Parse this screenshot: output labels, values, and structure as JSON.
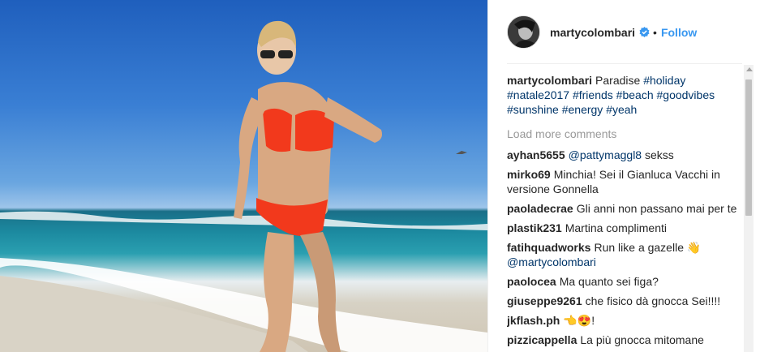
{
  "header": {
    "username": "martycolombari",
    "separator": "•",
    "follow_label": "Follow",
    "verified_icon": "verified-badge-icon",
    "accent_color": "#3897f0"
  },
  "caption": {
    "username": "martycolombari",
    "text": "Paradise",
    "hashtags": [
      "#holiday",
      "#natale2017",
      "#friends",
      "#beach",
      "#goodvibes",
      "#sunshine",
      "#energy",
      "#yeah"
    ]
  },
  "load_more_label": "Load more comments",
  "comments": [
    {
      "user": "ayhan5655",
      "mention": "@pattymaggl8",
      "text": "sekss"
    },
    {
      "user": "mirko69",
      "text": "Minchia! Sei il Gianluca Vacchi in versione Gonnella"
    },
    {
      "user": "paoladecrae",
      "text": "Gli anni non passano mai per te"
    },
    {
      "user": "plastik231",
      "text": "Martina complimenti"
    },
    {
      "user": "fatihquadworks",
      "text": "Run like a gazelle 👋",
      "mention": "@martycolombari"
    },
    {
      "user": "paolocea",
      "text": "Ma quanto sei figa?"
    },
    {
      "user": "giuseppe9261",
      "text": "che fisico dà gnocca Sei!!!!"
    },
    {
      "user": "jkflash.ph",
      "text": "👈😍!"
    },
    {
      "user": "pizzicappella",
      "text": "La più gnocca mitomane"
    }
  ]
}
